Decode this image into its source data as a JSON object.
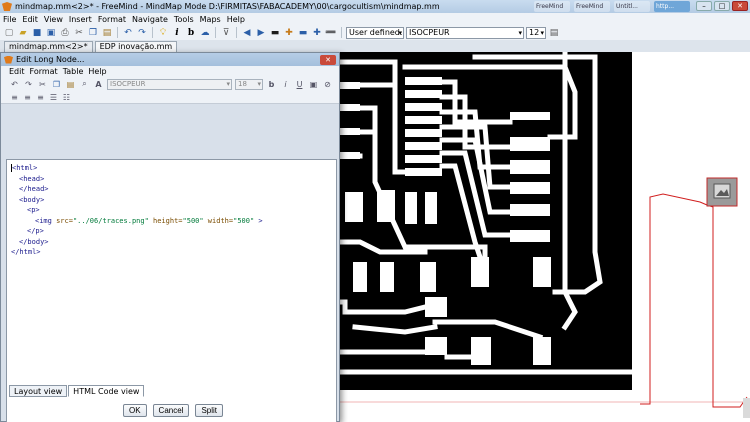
{
  "window": {
    "title": "mindmap.mm<2>* - FreeMind - MindMap Mode D:\\FIRMITAS\\FABACADEMY\\00\\cargocultism\\mindmap.mm",
    "taskbar_ghosts": [
      "FreeMind",
      "FreeMind",
      "Untitl...",
      "http..."
    ]
  },
  "menubar": [
    "File",
    "Edit",
    "View",
    "Insert",
    "Format",
    "Navigate",
    "Tools",
    "Maps",
    "Help"
  ],
  "toolbar": {
    "style_select": "User defined.",
    "font_select": "ISOCPEUR",
    "size_select": "12"
  },
  "map_tabs": [
    "mindmap.mm<2>*",
    "EDP inovação.mm"
  ],
  "dialog": {
    "title": "Edit Long Node...",
    "menu": [
      "Edit",
      "Format",
      "Table",
      "Help"
    ],
    "font_select": "ISOCPEUR",
    "size_select": "18",
    "code_lines": [
      {
        "text": "<html>",
        "indent": 0,
        "kind": "tag"
      },
      {
        "text": "<head>",
        "indent": 1,
        "kind": "tag"
      },
      {
        "text": "",
        "indent": 0,
        "kind": "blank"
      },
      {
        "text": "</head>",
        "indent": 1,
        "kind": "tag"
      },
      {
        "text": "<body>",
        "indent": 1,
        "kind": "tag"
      },
      {
        "text": "<p>",
        "indent": 2,
        "kind": "tag"
      },
      {
        "text": "<img src=\"../06/traces.png\" height=\"500\" width=\"500\" >",
        "indent": 3,
        "kind": "img"
      },
      {
        "text": "</p>",
        "indent": 2,
        "kind": "tag"
      },
      {
        "text": "</body>",
        "indent": 1,
        "kind": "tag"
      },
      {
        "text": "</html>",
        "indent": 0,
        "kind": "tag"
      }
    ],
    "tabs": {
      "layout": "Layout view",
      "html": "HTML Code view"
    },
    "buttons": {
      "ok": "OK",
      "cancel": "Cancel",
      "split": "Split"
    }
  }
}
